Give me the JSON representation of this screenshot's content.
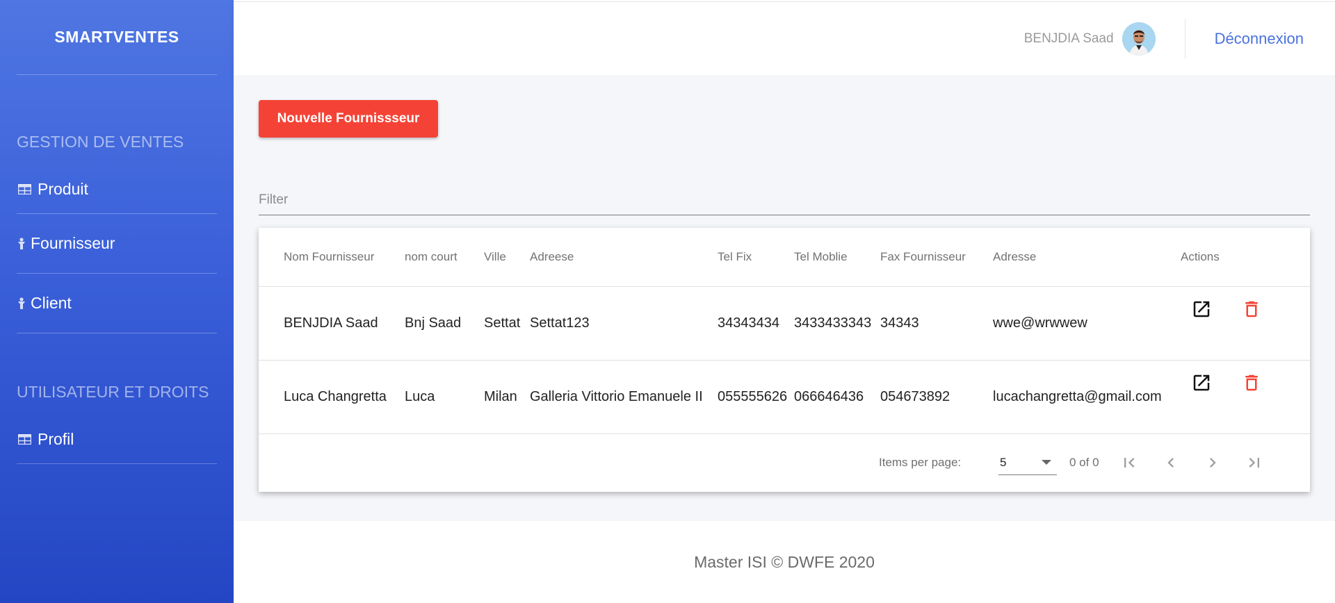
{
  "app": {
    "brand": "SMARTVENTES"
  },
  "sidebar": {
    "sections": [
      {
        "title": "GESTION DE VENTES"
      },
      {
        "title": "UTILISATEUR ET DROITS"
      }
    ],
    "items": [
      {
        "label": "Produit",
        "icon": "table-icon"
      },
      {
        "label": "Fournisseur",
        "icon": "person-icon"
      },
      {
        "label": "Client",
        "icon": "person-icon"
      },
      {
        "label": "Profil",
        "icon": "table-icon"
      }
    ]
  },
  "header": {
    "user_name": "BENJDIA Saad",
    "logout_label": "Déconnexion"
  },
  "main": {
    "new_button_label": "Nouvelle Fournissseur",
    "filter_placeholder": "Filter",
    "table": {
      "columns": [
        "Nom Fournisseur",
        "nom court",
        "Ville",
        "Adreese",
        "Tel Fix",
        "Tel Moblie",
        "Fax Fournisseur",
        "Adresse",
        "Actions"
      ],
      "rows": [
        [
          "BENJDIA Saad",
          "Bnj Saad",
          "Settat",
          "Settat123",
          "34343434",
          "3433433343",
          "34343",
          "wwe@wrwwew"
        ],
        [
          "Luca Changretta",
          "Luca",
          "Milan",
          "Galleria Vittorio Emanuele II",
          "055555626",
          "066646436",
          "054673892",
          "lucachangretta@gmail.com"
        ]
      ]
    },
    "paginator": {
      "items_per_page_label": "Items per page:",
      "items_per_page_value": "5",
      "range_label": "0 of 0"
    }
  },
  "footer": {
    "text": "Master ISI © DWFE 2020"
  },
  "colors": {
    "sidebar_top": "#4f76e2",
    "sidebar_bottom": "#2446c4",
    "primary_button": "#f44336",
    "delete_icon": "#f44336",
    "link": "#4a72dd"
  }
}
